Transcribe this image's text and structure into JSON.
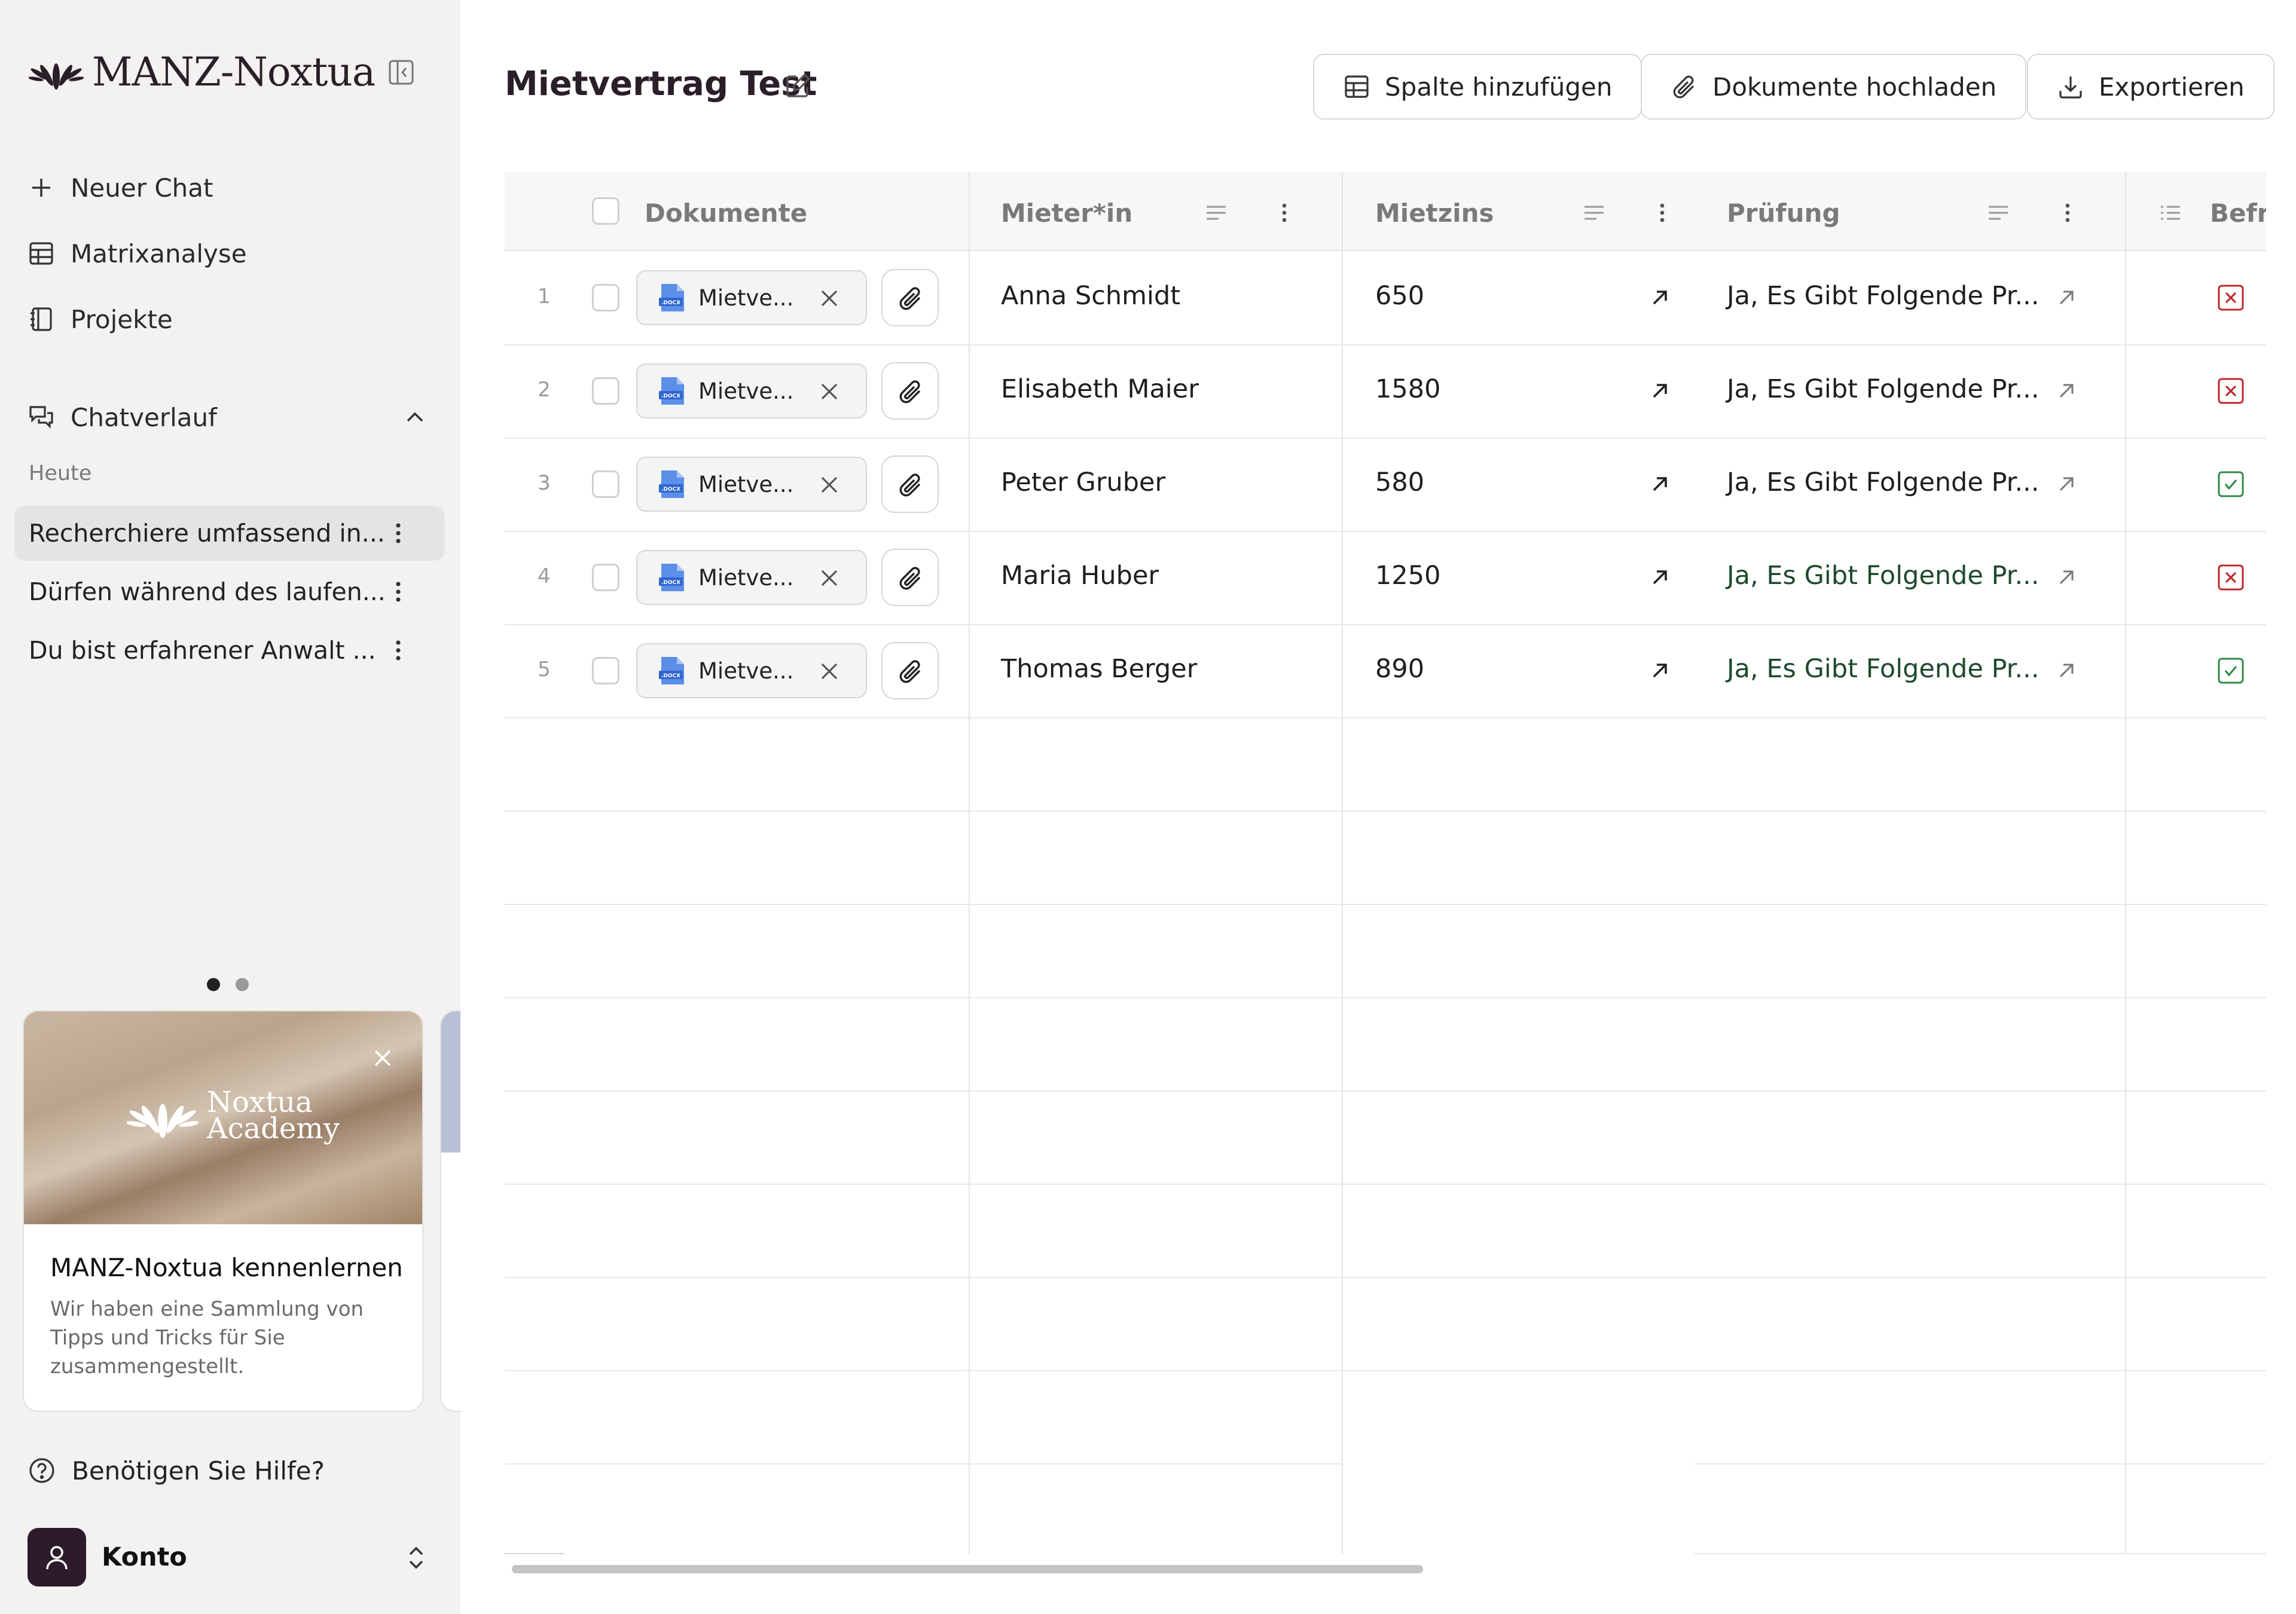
{
  "sidebar": {
    "brand": "MANZ-Noxtua",
    "nav": [
      {
        "label": "Neuer Chat",
        "icon": "plus-icon"
      },
      {
        "label": "Matrixanalyse",
        "icon": "table-icon"
      },
      {
        "label": "Projekte",
        "icon": "notebook-icon"
      }
    ],
    "chat_history_label": "Chatverlauf",
    "today_label": "Heute",
    "chats": [
      {
        "title": "Recherchiere umfassend in...",
        "active": true
      },
      {
        "title": "Dürfen während des laufen...",
        "active": false
      },
      {
        "title": "Du bist erfahrener Anwalt ...",
        "active": false
      }
    ],
    "promo": {
      "image_text_line1": "Noxtua",
      "image_text_line2": "Academy",
      "title": "MANZ-Noxtua kennenlernen",
      "description": "Wir haben eine Sammlung von Tipps und Tricks für Sie zusammengestellt."
    },
    "help_label": "Benötigen Sie Hilfe?",
    "account_label": "Konto"
  },
  "main": {
    "title": "Mietvertrag Test",
    "buttons": {
      "add_column": "Spalte hinzufügen",
      "upload": "Dokumente hochladen",
      "export": "Exportieren"
    },
    "columns": [
      "Dokumente",
      "Mieter*in",
      "Mietzins",
      "Prüfung",
      "Befri"
    ],
    "rows": [
      {
        "num": "1",
        "doc": "Mietve...",
        "tenant": "Anna Schmidt",
        "rent": "650",
        "check": "Ja, Es Gibt Folgende Pr...",
        "status": "no"
      },
      {
        "num": "2",
        "doc": "Mietve...",
        "tenant": "Elisabeth Maier",
        "rent": "1580",
        "check": "Ja, Es Gibt Folgende Pr...",
        "status": "no"
      },
      {
        "num": "3",
        "doc": "Mietve...",
        "tenant": "Peter Gruber",
        "rent": "580",
        "check": "Ja, Es Gibt Folgende Pr...",
        "status": "yes"
      },
      {
        "num": "4",
        "doc": "Mietve...",
        "tenant": "Maria Huber",
        "rent": "1250",
        "check": "Ja, Es Gibt Folgende Pr...",
        "status": "no"
      },
      {
        "num": "5",
        "doc": "Mietve...",
        "tenant": "Thomas Berger",
        "rent": "890",
        "check": "Ja, Es Gibt Folgende Pr...",
        "status": "yes"
      }
    ]
  },
  "colors": {
    "sidebar_bg": "#f3f2f1",
    "brand_dark": "#2a1f29",
    "status_no": "#c0282d",
    "status_yes": "#2f8a4a"
  }
}
